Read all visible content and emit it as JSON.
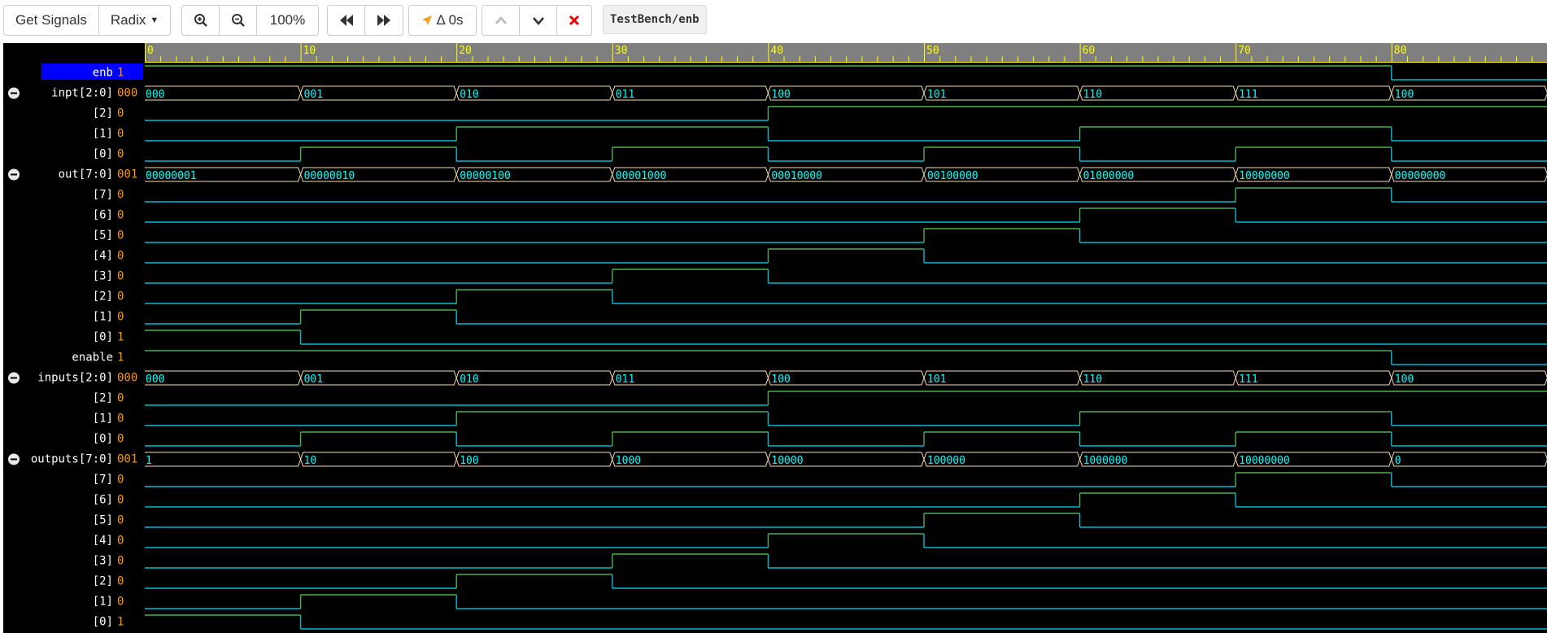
{
  "toolbar": {
    "get_signals": "Get Signals",
    "radix": "Radix",
    "zoom_level": "100%",
    "delta": "Δ 0s",
    "path": "TestBench/enb"
  },
  "timeline": {
    "ticks": [
      "0",
      "10",
      "20",
      "30",
      "40",
      "50",
      "60",
      "70",
      "80"
    ],
    "max_time": 90
  },
  "colors": {
    "background": "#000000",
    "wave_low": "#00bcd4",
    "wave_high": "#4caf50",
    "bus_outline": "#f5deb3",
    "bus_text": "#00ffff",
    "value_text": "#ff9800",
    "name_text": "#ffffff",
    "selected_bg": "#0000ff",
    "ruler_text": "#ffff00",
    "ruler_bg": "#7f7f7f"
  },
  "signals": [
    {
      "name": "enb",
      "value": "1",
      "kind": "bit",
      "selected": true,
      "changes": [
        [
          0,
          1
        ],
        [
          80,
          0
        ]
      ]
    },
    {
      "name": "inpt[2:0]",
      "value": "000",
      "kind": "bus",
      "collapsible": true,
      "segments": [
        [
          0,
          "000"
        ],
        [
          10,
          "001"
        ],
        [
          20,
          "010"
        ],
        [
          30,
          "011"
        ],
        [
          40,
          "100"
        ],
        [
          50,
          "101"
        ],
        [
          60,
          "110"
        ],
        [
          70,
          "111"
        ],
        [
          80,
          "100"
        ]
      ]
    },
    {
      "name": "[2]",
      "value": "0",
      "kind": "bit",
      "changes": [
        [
          0,
          0
        ],
        [
          40,
          1
        ]
      ]
    },
    {
      "name": "[1]",
      "value": "0",
      "kind": "bit",
      "changes": [
        [
          0,
          0
        ],
        [
          20,
          1
        ],
        [
          40,
          0
        ],
        [
          60,
          1
        ],
        [
          80,
          0
        ]
      ]
    },
    {
      "name": "[0]",
      "value": "0",
      "kind": "bit",
      "changes": [
        [
          0,
          0
        ],
        [
          10,
          1
        ],
        [
          20,
          0
        ],
        [
          30,
          1
        ],
        [
          40,
          0
        ],
        [
          50,
          1
        ],
        [
          60,
          0
        ],
        [
          70,
          1
        ],
        [
          80,
          0
        ]
      ]
    },
    {
      "name": "out[7:0]",
      "value": "001",
      "kind": "bus",
      "collapsible": true,
      "segments": [
        [
          0,
          "00000001"
        ],
        [
          10,
          "00000010"
        ],
        [
          20,
          "00000100"
        ],
        [
          30,
          "00001000"
        ],
        [
          40,
          "00010000"
        ],
        [
          50,
          "00100000"
        ],
        [
          60,
          "01000000"
        ],
        [
          70,
          "10000000"
        ],
        [
          80,
          "00000000"
        ]
      ]
    },
    {
      "name": "[7]",
      "value": "0",
      "kind": "bit",
      "changes": [
        [
          0,
          0
        ],
        [
          70,
          1
        ],
        [
          80,
          0
        ]
      ]
    },
    {
      "name": "[6]",
      "value": "0",
      "kind": "bit",
      "changes": [
        [
          0,
          0
        ],
        [
          60,
          1
        ],
        [
          70,
          0
        ]
      ]
    },
    {
      "name": "[5]",
      "value": "0",
      "kind": "bit",
      "changes": [
        [
          0,
          0
        ],
        [
          50,
          1
        ],
        [
          60,
          0
        ]
      ]
    },
    {
      "name": "[4]",
      "value": "0",
      "kind": "bit",
      "changes": [
        [
          0,
          0
        ],
        [
          40,
          1
        ],
        [
          50,
          0
        ]
      ]
    },
    {
      "name": "[3]",
      "value": "0",
      "kind": "bit",
      "changes": [
        [
          0,
          0
        ],
        [
          30,
          1
        ],
        [
          40,
          0
        ]
      ]
    },
    {
      "name": "[2]",
      "value": "0",
      "kind": "bit",
      "changes": [
        [
          0,
          0
        ],
        [
          20,
          1
        ],
        [
          30,
          0
        ]
      ]
    },
    {
      "name": "[1]",
      "value": "0",
      "kind": "bit",
      "changes": [
        [
          0,
          0
        ],
        [
          10,
          1
        ],
        [
          20,
          0
        ]
      ]
    },
    {
      "name": "[0]",
      "value": "1",
      "kind": "bit",
      "changes": [
        [
          0,
          1
        ],
        [
          10,
          0
        ]
      ]
    },
    {
      "name": "enable",
      "value": "1",
      "kind": "bit",
      "changes": [
        [
          0,
          1
        ],
        [
          80,
          0
        ]
      ]
    },
    {
      "name": "inputs[2:0]",
      "value": "000",
      "kind": "bus",
      "collapsible": true,
      "segments": [
        [
          0,
          "000"
        ],
        [
          10,
          "001"
        ],
        [
          20,
          "010"
        ],
        [
          30,
          "011"
        ],
        [
          40,
          "100"
        ],
        [
          50,
          "101"
        ],
        [
          60,
          "110"
        ],
        [
          70,
          "111"
        ],
        [
          80,
          "100"
        ]
      ]
    },
    {
      "name": "[2]",
      "value": "0",
      "kind": "bit",
      "changes": [
        [
          0,
          0
        ],
        [
          40,
          1
        ]
      ]
    },
    {
      "name": "[1]",
      "value": "0",
      "kind": "bit",
      "changes": [
        [
          0,
          0
        ],
        [
          20,
          1
        ],
        [
          40,
          0
        ],
        [
          60,
          1
        ],
        [
          80,
          0
        ]
      ]
    },
    {
      "name": "[0]",
      "value": "0",
      "kind": "bit",
      "changes": [
        [
          0,
          0
        ],
        [
          10,
          1
        ],
        [
          20,
          0
        ],
        [
          30,
          1
        ],
        [
          40,
          0
        ],
        [
          50,
          1
        ],
        [
          60,
          0
        ],
        [
          70,
          1
        ],
        [
          80,
          0
        ]
      ]
    },
    {
      "name": "outputs[7:0]",
      "value": "001",
      "kind": "bus",
      "collapsible": true,
      "segments": [
        [
          0,
          "1"
        ],
        [
          10,
          "10"
        ],
        [
          20,
          "100"
        ],
        [
          30,
          "1000"
        ],
        [
          40,
          "10000"
        ],
        [
          50,
          "100000"
        ],
        [
          60,
          "1000000"
        ],
        [
          70,
          "10000000"
        ],
        [
          80,
          "0"
        ]
      ]
    },
    {
      "name": "[7]",
      "value": "0",
      "kind": "bit",
      "changes": [
        [
          0,
          0
        ],
        [
          70,
          1
        ],
        [
          80,
          0
        ]
      ]
    },
    {
      "name": "[6]",
      "value": "0",
      "kind": "bit",
      "changes": [
        [
          0,
          0
        ],
        [
          60,
          1
        ],
        [
          70,
          0
        ]
      ]
    },
    {
      "name": "[5]",
      "value": "0",
      "kind": "bit",
      "changes": [
        [
          0,
          0
        ],
        [
          50,
          1
        ],
        [
          60,
          0
        ]
      ]
    },
    {
      "name": "[4]",
      "value": "0",
      "kind": "bit",
      "changes": [
        [
          0,
          0
        ],
        [
          40,
          1
        ],
        [
          50,
          0
        ]
      ]
    },
    {
      "name": "[3]",
      "value": "0",
      "kind": "bit",
      "changes": [
        [
          0,
          0
        ],
        [
          30,
          1
        ],
        [
          40,
          0
        ]
      ]
    },
    {
      "name": "[2]",
      "value": "0",
      "kind": "bit",
      "changes": [
        [
          0,
          0
        ],
        [
          20,
          1
        ],
        [
          30,
          0
        ]
      ]
    },
    {
      "name": "[1]",
      "value": "0",
      "kind": "bit",
      "changes": [
        [
          0,
          0
        ],
        [
          10,
          1
        ],
        [
          20,
          0
        ]
      ]
    },
    {
      "name": "[0]",
      "value": "1",
      "kind": "bit",
      "changes": [
        [
          0,
          1
        ],
        [
          10,
          0
        ]
      ]
    }
  ]
}
